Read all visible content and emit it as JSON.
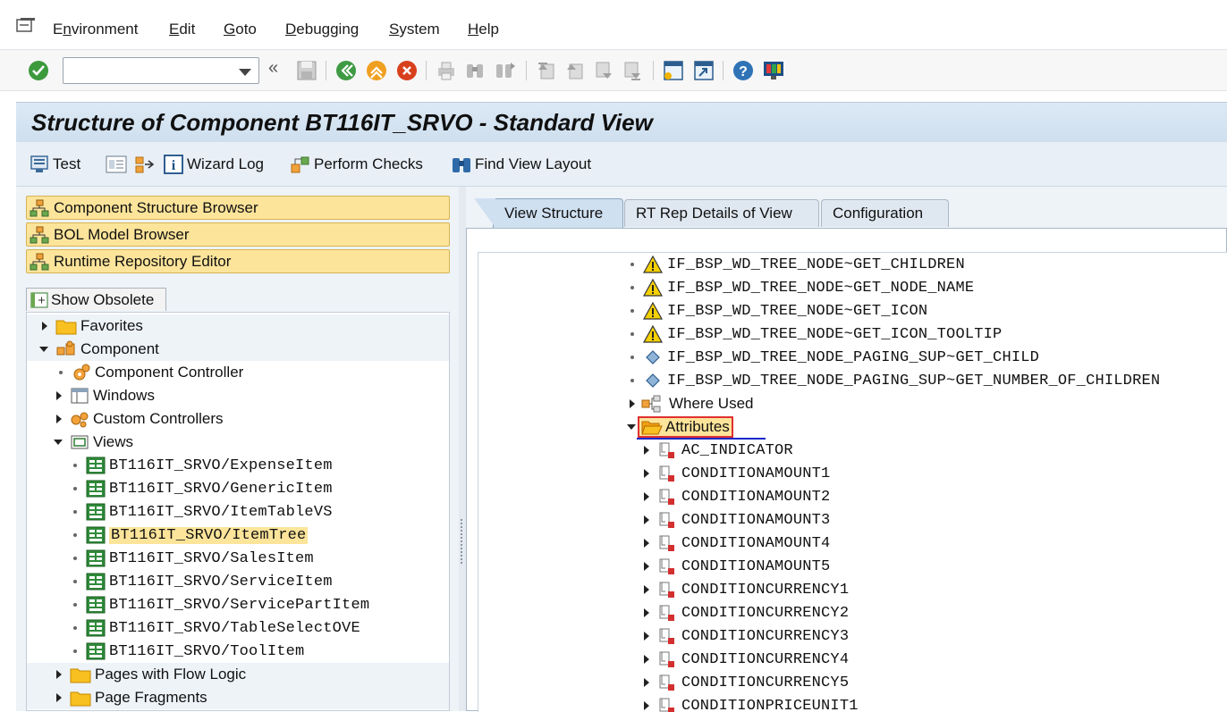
{
  "menubar": {
    "items": [
      {
        "pre": "E",
        "ul": "n",
        "post": "vironment"
      },
      {
        "pre": "",
        "ul": "E",
        "post": "dit"
      },
      {
        "pre": "",
        "ul": "G",
        "post": "oto"
      },
      {
        "pre": "",
        "ul": "D",
        "post": "ebugging"
      },
      {
        "pre": "",
        "ul": "S",
        "post": "ystem"
      },
      {
        "pre": "",
        "ul": "H",
        "post": "elp"
      }
    ]
  },
  "systoolbar": {
    "command_value": "",
    "back_glyph": "«",
    "icons": [
      "enter-icon",
      "save-icon",
      "back-icon",
      "exit-icon",
      "cancel-icon",
      "print-icon",
      "find-icon",
      "find-next-icon",
      "first-page-icon",
      "previous-page-icon",
      "next-page-icon",
      "last-page-icon",
      "create-session-icon",
      "shortcut-icon",
      "help-icon",
      "customize-layout-icon"
    ]
  },
  "title": "Structure of Component BT116IT_SRVO - Standard View",
  "apptoolbar": {
    "test": "Test",
    "wizard_log": "Wizard Log",
    "perform_checks": "Perform Checks",
    "find_view_layout": "Find View Layout"
  },
  "left": {
    "nav_buttons": [
      "Component Structure Browser",
      "BOL Model Browser",
      "Runtime Repository Editor"
    ],
    "show_obsolete": "Show Obsolete",
    "tree": {
      "favorites": "Favorites",
      "component": "Component",
      "component_controller": "Component Controller",
      "windows": "Windows",
      "custom_controllers": "Custom Controllers",
      "views": "Views",
      "view_items": [
        "BT116IT_SRVO/ExpenseItem",
        "BT116IT_SRVO/GenericItem",
        "BT116IT_SRVO/ItemTableVS",
        "BT116IT_SRVO/ItemTree",
        "BT116IT_SRVO/SalesItem",
        "BT116IT_SRVO/ServiceItem",
        "BT116IT_SRVO/ServicePartItem",
        "BT116IT_SRVO/TableSelectOVE",
        "BT116IT_SRVO/ToolItem"
      ],
      "selected_view": "BT116IT_SRVO/ItemTree",
      "pages_flow": "Pages with Flow Logic",
      "page_fragments": "Page Fragments"
    }
  },
  "right": {
    "tabs": [
      "View Structure",
      "RT Rep Details of View",
      "Configuration"
    ],
    "active_tab": "View Structure",
    "methods": [
      {
        "name": "IF_BSP_WD_TREE_NODE~GET_CHILDREN",
        "icon": "warning-icon"
      },
      {
        "name": "IF_BSP_WD_TREE_NODE~GET_NODE_NAME",
        "icon": "warning-icon"
      },
      {
        "name": "IF_BSP_WD_TREE_NODE~GET_ICON",
        "icon": "warning-icon"
      },
      {
        "name": "IF_BSP_WD_TREE_NODE~GET_ICON_TOOLTIP",
        "icon": "warning-icon"
      },
      {
        "name": "IF_BSP_WD_TREE_NODE_PAGING_SUP~GET_CHILD",
        "icon": "method-diamond-icon"
      },
      {
        "name": "IF_BSP_WD_TREE_NODE_PAGING_SUP~GET_NUMBER_OF_CHILDREN",
        "icon": "method-diamond-icon"
      }
    ],
    "where_used": "Where Used",
    "attributes": "Attributes",
    "attribute_items": [
      "AC_INDICATOR",
      "CONDITIONAMOUNT1",
      "CONDITIONAMOUNT2",
      "CONDITIONAMOUNT3",
      "CONDITIONAMOUNT4",
      "CONDITIONAMOUNT5",
      "CONDITIONCURRENCY1",
      "CONDITIONCURRENCY2",
      "CONDITIONCURRENCY3",
      "CONDITIONCURRENCY4",
      "CONDITIONCURRENCY5",
      "CONDITIONPRICEUNIT1"
    ]
  },
  "colors": {
    "nav_button": "#fce49a",
    "title_bg": "#d5e4f2",
    "selection": "#fce49a",
    "focus_border": "#e03030",
    "underline": "#1428c8"
  }
}
